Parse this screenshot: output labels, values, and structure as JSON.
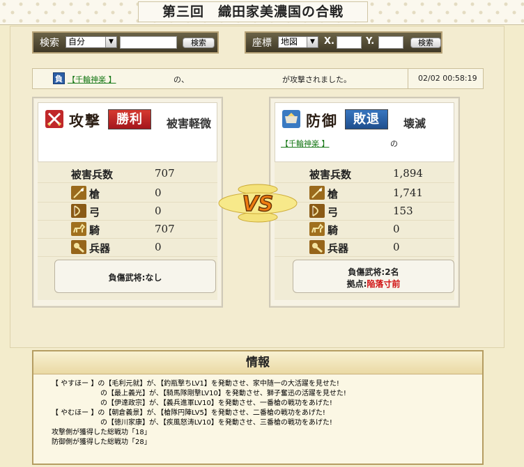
{
  "title": "第三回　織田家美濃国の合戦",
  "search": {
    "label": "検索",
    "select_value": "自分",
    "button": "検索"
  },
  "coords": {
    "label": "座標",
    "select_value": "地図",
    "x_label": "X.",
    "y_label": "Y.",
    "button": "検索"
  },
  "notice": {
    "badge": "負",
    "player": "【千輪神楽 】",
    "middle": "の、",
    "suffix": "が攻撃されました。",
    "time": "02/02 00:58:19"
  },
  "attack": {
    "title": "攻撃",
    "result": "勝利",
    "damage_status": "被害軽微",
    "losses_label": "被害兵数",
    "losses": "707",
    "units": [
      {
        "icon": "spear-icon",
        "label": "槍",
        "value": "0"
      },
      {
        "icon": "bow-icon",
        "label": "弓",
        "value": "0"
      },
      {
        "icon": "horse-icon",
        "label": "騎",
        "value": "707"
      },
      {
        "icon": "weapon-icon",
        "label": "兵器",
        "value": "0"
      }
    ],
    "summary": "負傷武将:なし"
  },
  "defense": {
    "title": "防御",
    "result": "敗退",
    "damage_status": "壊滅",
    "player": "【千輪神楽 】",
    "player_suffix": "の",
    "losses_label": "被害兵数",
    "losses": "1,894",
    "units": [
      {
        "icon": "spear-icon",
        "label": "槍",
        "value": "1,741"
      },
      {
        "icon": "bow-icon",
        "label": "弓",
        "value": "153"
      },
      {
        "icon": "horse-icon",
        "label": "騎",
        "value": "0"
      },
      {
        "icon": "weapon-icon",
        "label": "兵器",
        "value": "0"
      }
    ],
    "summary_line1": "負傷武将:2名",
    "summary_label": "拠点:",
    "summary_value": "陥落寸前"
  },
  "vs_text": "VS",
  "info": {
    "title": "情報",
    "lines": [
      "【 やすほー 】の【毛利元就】が、【釣瓶撃ちLV1】を発動させ、家中随一の大活躍を見せた!",
      "　　　　　　　の【最上義光】が、【騎馬隊剛撃LV10】を発動させ、獅子奮迅の活躍を見せた!",
      "　　　　　　　の【伊達政宗】が、【義兵進軍LV10】を発動させ、一番槍の戦功をあげた!",
      "【 やむほー 】の【朝倉義景】が、【槍隊円陣LV5】を発動させ、二番槍の戦功をあげた!",
      "　　　　　　　の【徳川家康】が、【疾風怒涛LV10】を発動させ、三番槍の戦功をあげた!",
      "攻撃側が獲得した総戦功「18」",
      "防御側が獲得した総戦功「28」"
    ]
  },
  "colors": {
    "win": "#c0282a",
    "lose": "#245ea6",
    "danger": "#d01010",
    "link": "#1a7a1a"
  }
}
